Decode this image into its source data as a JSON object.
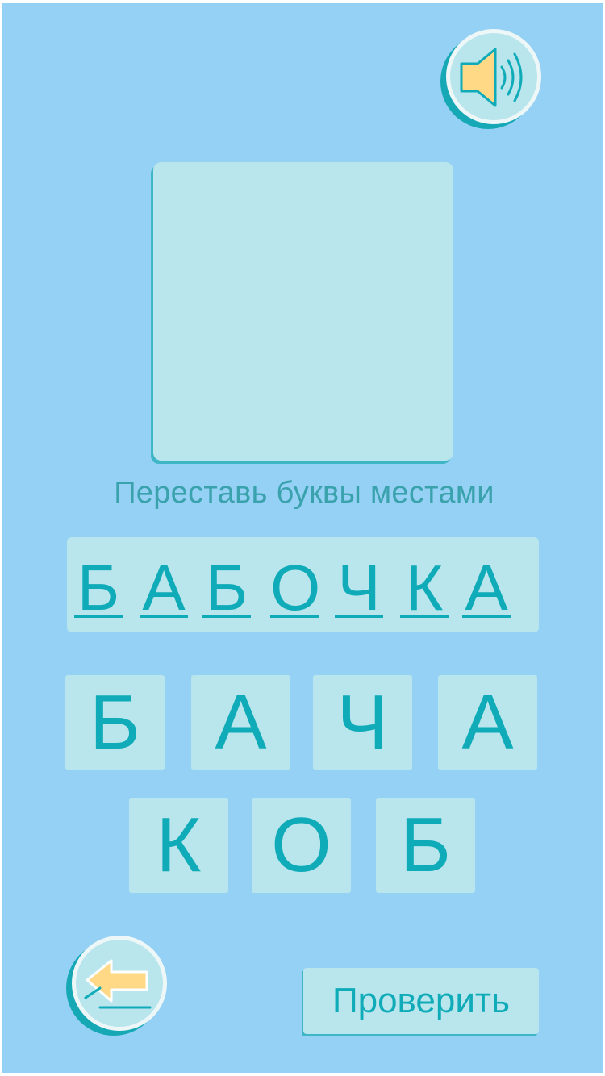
{
  "instruction": "Переставь буквы местами",
  "answer_letters": [
    "Б",
    "А",
    "Б",
    "О",
    "Ч",
    "К",
    "А"
  ],
  "tiles_row1": [
    "Б",
    "А",
    "Ч",
    "А"
  ],
  "tiles_row2": [
    "К",
    "О",
    "Б"
  ],
  "check_label": "Проверить",
  "icons": {
    "sound": "speaker-icon",
    "back": "back-arrow-icon"
  },
  "colors": {
    "background": "#95d1f5",
    "panel": "#b8e6ec",
    "accent": "#10abb8",
    "icon": "#ffd986"
  }
}
